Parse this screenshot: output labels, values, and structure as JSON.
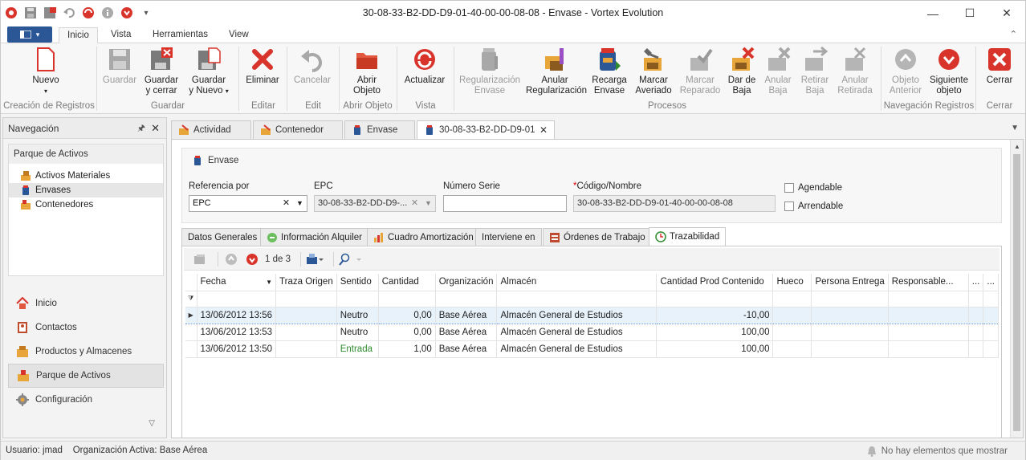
{
  "window": {
    "title": "30-08-33-B2-DD-D9-01-40-00-00-08-08 - Envase - Vortex Evolution",
    "minimize": "—",
    "maximize": "☐",
    "close": "✕"
  },
  "ribbon_tabs": {
    "inicio": "Inicio",
    "vista": "Vista",
    "herramientas": "Herramientas",
    "view": "View",
    "collapse": "⌃"
  },
  "ribbon": {
    "nuevo": "Nuevo",
    "guardar": "Guardar",
    "guardar_cerrar_1": "Guardar",
    "guardar_cerrar_2": "y cerrar",
    "guardar_nuevo_1": "Guardar",
    "guardar_nuevo_2": "y Nuevo",
    "eliminar": "Eliminar",
    "cancelar": "Cancelar",
    "abrir_1": "Abrir",
    "abrir_2": "Objeto",
    "actualizar": "Actualizar",
    "regularizacion_1": "Regularización",
    "regularizacion_2": "Envase",
    "anular_reg_1": "Anular",
    "anular_reg_2": "Regularización",
    "recarga_1": "Recarga",
    "recarga_2": "Envase",
    "marcar_averiado_1": "Marcar",
    "marcar_averiado_2": "Averiado",
    "marcar_reparado_1": "Marcar",
    "marcar_reparado_2": "Reparado",
    "dar_baja_1": "Dar de",
    "dar_baja_2": "Baja",
    "anular_baja_1": "Anular",
    "anular_baja_2": "Baja",
    "retirar_baja_1": "Retirar",
    "retirar_baja_2": "Baja",
    "anular_retirada_1": "Anular",
    "anular_retirada_2": "Retirada",
    "objeto_anterior_1": "Objeto",
    "objeto_anterior_2": "Anterior",
    "siguiente_1": "Siguiente",
    "siguiente_2": "objeto",
    "cerrar": "Cerrar",
    "groups": {
      "creacion": "Creación de Registros",
      "guardar": "Guardar",
      "editar": "Editar",
      "edit": "Edit",
      "abrir": "Abrir Objeto",
      "vista": "Vista",
      "procesos": "Procesos",
      "navegacion": "Navegación Registros",
      "cerrar": "Cerrar"
    }
  },
  "nav": {
    "title": "Navegación",
    "section_title": "Parque de Activos",
    "tree": [
      "Activos Materiales",
      "Envases",
      "Contenedores"
    ],
    "buttons": [
      "Inicio",
      "Contactos",
      "Productos y Almacenes",
      "Parque de Activos",
      "Configuración"
    ]
  },
  "doc_tabs": [
    "Actividad",
    "Contenedor",
    "Envase",
    "30-08-33-B2-DD-D9-01"
  ],
  "entity": {
    "title": "Envase",
    "ref_label": "Referencia por",
    "ref_value": "EPC",
    "epc_label": "EPC",
    "epc_value": "30-08-33-B2-DD-D9-...",
    "serie_label": "Número Serie",
    "serie_value": "",
    "codigo_req": "*",
    "codigo_label": "Código/Nombre",
    "codigo_value": "30-08-33-B2-DD-D9-01-40-00-00-08-08",
    "agendable": "Agendable",
    "arrendable": "Arrendable"
  },
  "inner_tabs": [
    "Datos Generales",
    "Información Alquiler",
    "Cuadro Amortización",
    "Interviene en",
    "Órdenes de Trabajo",
    "Trazabilidad"
  ],
  "grid_toolbar": {
    "pager": "1 de 3"
  },
  "grid": {
    "columns": [
      "Fecha",
      "Traza Origen",
      "Sentido",
      "Cantidad",
      "Organización",
      "Almacén",
      "Cantidad Prod Contenido",
      "Hueco",
      "Persona Entrega",
      "Responsable...",
      "...",
      "..."
    ],
    "rows": [
      [
        "13/06/2012 13:56",
        "",
        "Neutro",
        "0,00",
        "Base Aérea",
        "Almacén General de Estudios",
        "-10,00",
        "",
        "",
        "",
        "",
        ""
      ],
      [
        "13/06/2012 13:53",
        "",
        "Neutro",
        "0,00",
        "Base Aérea",
        "Almacén General de Estudios",
        "100,00",
        "",
        "",
        "",
        "",
        ""
      ],
      [
        "13/06/2012 13:50",
        "",
        "Entrada",
        "1,00",
        "Base Aérea",
        "Almacén General de Estudios",
        "100,00",
        "",
        "",
        "",
        "",
        ""
      ]
    ]
  },
  "status": {
    "usuario": "Usuario: jmad",
    "organizacion": "Organización Activa: Base Aérea",
    "mensaje": "No hay elementos que mostrar"
  },
  "colors": {
    "accent": "#2b5797",
    "danger": "#d9342b",
    "entrada": "#2e8b2e"
  }
}
